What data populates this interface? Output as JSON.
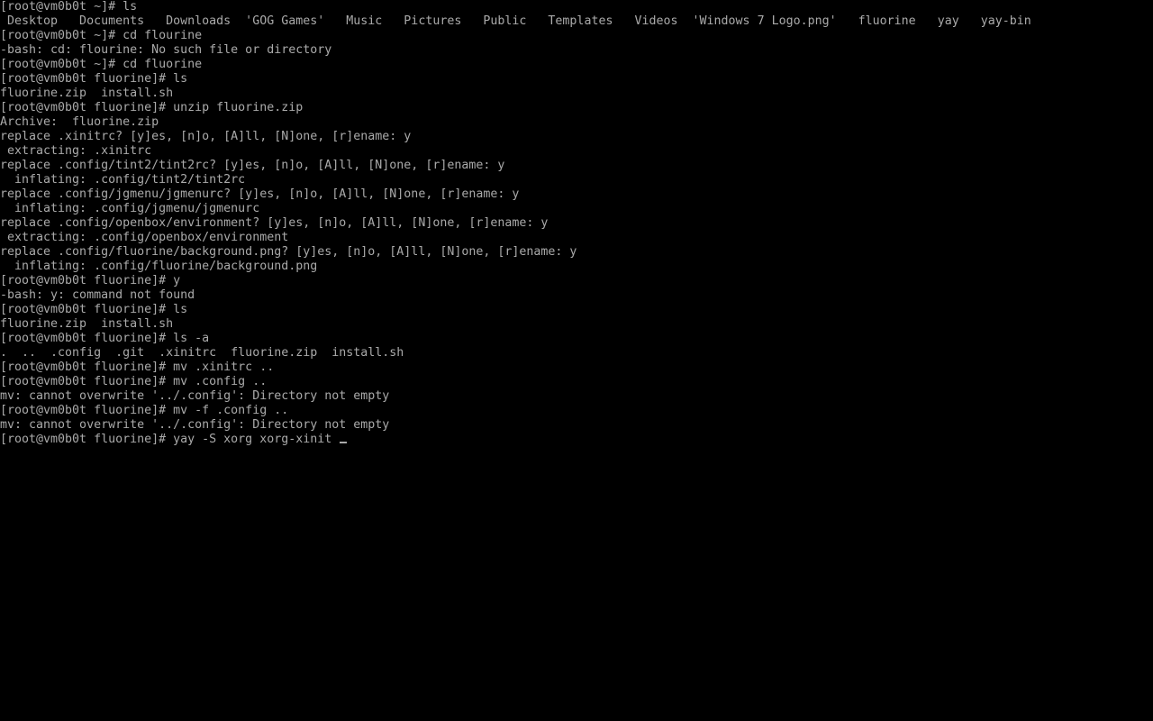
{
  "terminal": {
    "colors": {
      "background": "#000000",
      "foreground": "#aaaaaa"
    },
    "cursor": "_",
    "lines": [
      "[root@vm0b0t ~]# ls",
      " Desktop   Documents   Downloads  'GOG Games'   Music   Pictures   Public   Templates   Videos  'Windows 7 Logo.png'   fluorine   yay   yay-bin",
      "[root@vm0b0t ~]# cd flourine",
      "-bash: cd: flourine: No such file or directory",
      "[root@vm0b0t ~]# cd fluorine",
      "[root@vm0b0t fluorine]# ls",
      "fluorine.zip  install.sh",
      "[root@vm0b0t fluorine]# unzip fluorine.zip",
      "Archive:  fluorine.zip",
      "replace .xinitrc? [y]es, [n]o, [A]ll, [N]one, [r]ename: y",
      " extracting: .xinitrc",
      "replace .config/tint2/tint2rc? [y]es, [n]o, [A]ll, [N]one, [r]ename: y",
      "  inflating: .config/tint2/tint2rc",
      "replace .config/jgmenu/jgmenurc? [y]es, [n]o, [A]ll, [N]one, [r]ename: y",
      "  inflating: .config/jgmenu/jgmenurc",
      "replace .config/openbox/environment? [y]es, [n]o, [A]ll, [N]one, [r]ename: y",
      " extracting: .config/openbox/environment",
      "replace .config/fluorine/background.png? [y]es, [n]o, [A]ll, [N]one, [r]ename: y",
      "  inflating: .config/fluorine/background.png",
      "[root@vm0b0t fluorine]# y",
      "-bash: y: command not found",
      "[root@vm0b0t fluorine]# ls",
      "fluorine.zip  install.sh",
      "[root@vm0b0t fluorine]# ls -a",
      ".  ..  .config  .git  .xinitrc  fluorine.zip  install.sh",
      "[root@vm0b0t fluorine]# mv .xinitrc ..",
      "[root@vm0b0t fluorine]# mv .config ..",
      "mv: cannot overwrite '../.config': Directory not empty",
      "[root@vm0b0t fluorine]# mv -f .config ..",
      "mv: cannot overwrite '../.config': Directory not empty"
    ],
    "current_input": "[root@vm0b0t fluorine]# yay -S xorg xorg-xinit "
  }
}
